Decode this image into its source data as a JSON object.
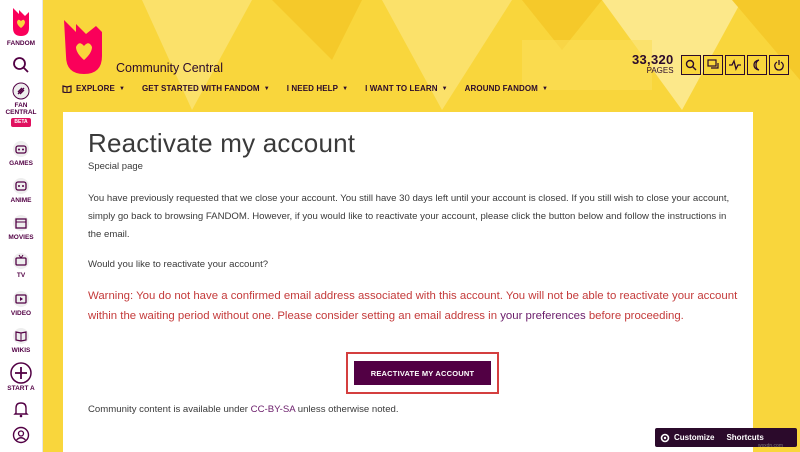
{
  "rail": {
    "brand": "FANDOM",
    "fan_central": "FAN\nCENTRAL",
    "meta": "BETA",
    "games": "GAMES",
    "anime": "ANIME",
    "movies": "MOVIES",
    "tv": "TV",
    "video": "VIDEO",
    "wikis": "WIKIS",
    "start": "START A"
  },
  "site": {
    "name": "Community Central",
    "pages_count": "33,320",
    "pages_label": "PAGES"
  },
  "nav": [
    "EXPLORE",
    "GET STARTED WITH FANDOM",
    "I NEED HELP",
    "I WANT TO LEARN",
    "AROUND FANDOM"
  ],
  "page": {
    "title": "Reactivate my account",
    "subtitle": "Special page",
    "paragraph": "You have previously requested that we close your account. You still have 30 days left until your account is closed. If you still wish to close your account, simply go back to browsing FANDOM. However, if you would like to reactivate your account, please click the button below and follow the instructions in the email.",
    "question": "Would you like to reactivate your account?",
    "warning_before": "Warning: You do not have a confirmed email address associated with this account. You will not be able to reactivate your account within the waiting period without one. Please consider setting an email address in ",
    "warning_link": "your preferences",
    "warning_after": " before proceeding.",
    "button": "REACTIVATE MY ACCOUNT",
    "footer_before": "Community content is available under ",
    "footer_link": "CC-BY-SA",
    "footer_after": " unless otherwise noted."
  },
  "toolbar": {
    "customize": "Customize",
    "shortcuts": "Shortcuts"
  },
  "watermark": "wsxdn.com",
  "colors": {
    "accent": "#520044",
    "banner": "#f9d63c",
    "warning": "#c43a3a",
    "highlight": "#d43f3f"
  }
}
